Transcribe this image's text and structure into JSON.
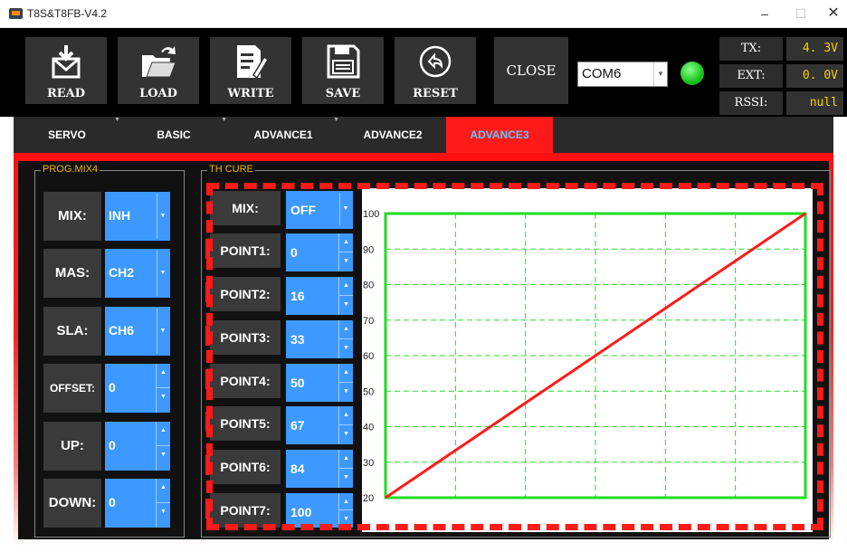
{
  "window": {
    "title": "T8S&T8FB-V4.2",
    "minimize": "–",
    "maximize": "☐",
    "close": "✕"
  },
  "toolbar": {
    "read": "READ",
    "load": "LOAD",
    "write": "WRITE",
    "save": "SAVE",
    "reset": "RESET",
    "close": "CLOSE",
    "port": "COM6",
    "port_status_color": "#19c419"
  },
  "status": {
    "tx_label": "TX:",
    "tx_value": "4. 3V",
    "ext_label": "EXT:",
    "ext_value": "0. 0V",
    "rssi_label": "RSSI:",
    "rssi_value": "null"
  },
  "tabs": [
    {
      "label": "SERVO"
    },
    {
      "label": "BASIC"
    },
    {
      "label": "ADVANCE1"
    },
    {
      "label": "ADVANCE2"
    },
    {
      "label": "ADVANCE3",
      "active": true
    }
  ],
  "prog_mix": {
    "title": "PROG.MIX4",
    "rows": [
      {
        "label": "MIX:",
        "value": "INH"
      },
      {
        "label": "MAS:",
        "value": "CH2"
      },
      {
        "label": "SLA:",
        "value": "CH6"
      },
      {
        "label": "OFFSET:",
        "value": "0"
      },
      {
        "label": "UP:",
        "value": "0"
      },
      {
        "label": "DOWN:",
        "value": "0"
      }
    ]
  },
  "th_curve": {
    "title": "TH CURE",
    "mix_label": "MIX:",
    "mix_value": "OFF",
    "points": [
      {
        "label": "POINT1:",
        "value": "0"
      },
      {
        "label": "POINT2:",
        "value": "16"
      },
      {
        "label": "POINT3:",
        "value": "33"
      },
      {
        "label": "POINT4:",
        "value": "50"
      },
      {
        "label": "POINT5:",
        "value": "67"
      },
      {
        "label": "POINT6:",
        "value": "84"
      },
      {
        "label": "POINT7:",
        "value": "100"
      }
    ]
  },
  "chart_data": {
    "type": "line",
    "y_ticks": [
      "100",
      "90",
      "80",
      "70",
      "60",
      "50",
      "40",
      "30",
      "20"
    ],
    "ylim": [
      20,
      100
    ],
    "x": [
      0,
      16,
      33,
      50,
      67,
      84,
      100
    ],
    "values": [
      0,
      16,
      33,
      50,
      67,
      84,
      100
    ],
    "grid": true,
    "line_color": "#ff1a1a",
    "frame_color": "#22dd22"
  }
}
